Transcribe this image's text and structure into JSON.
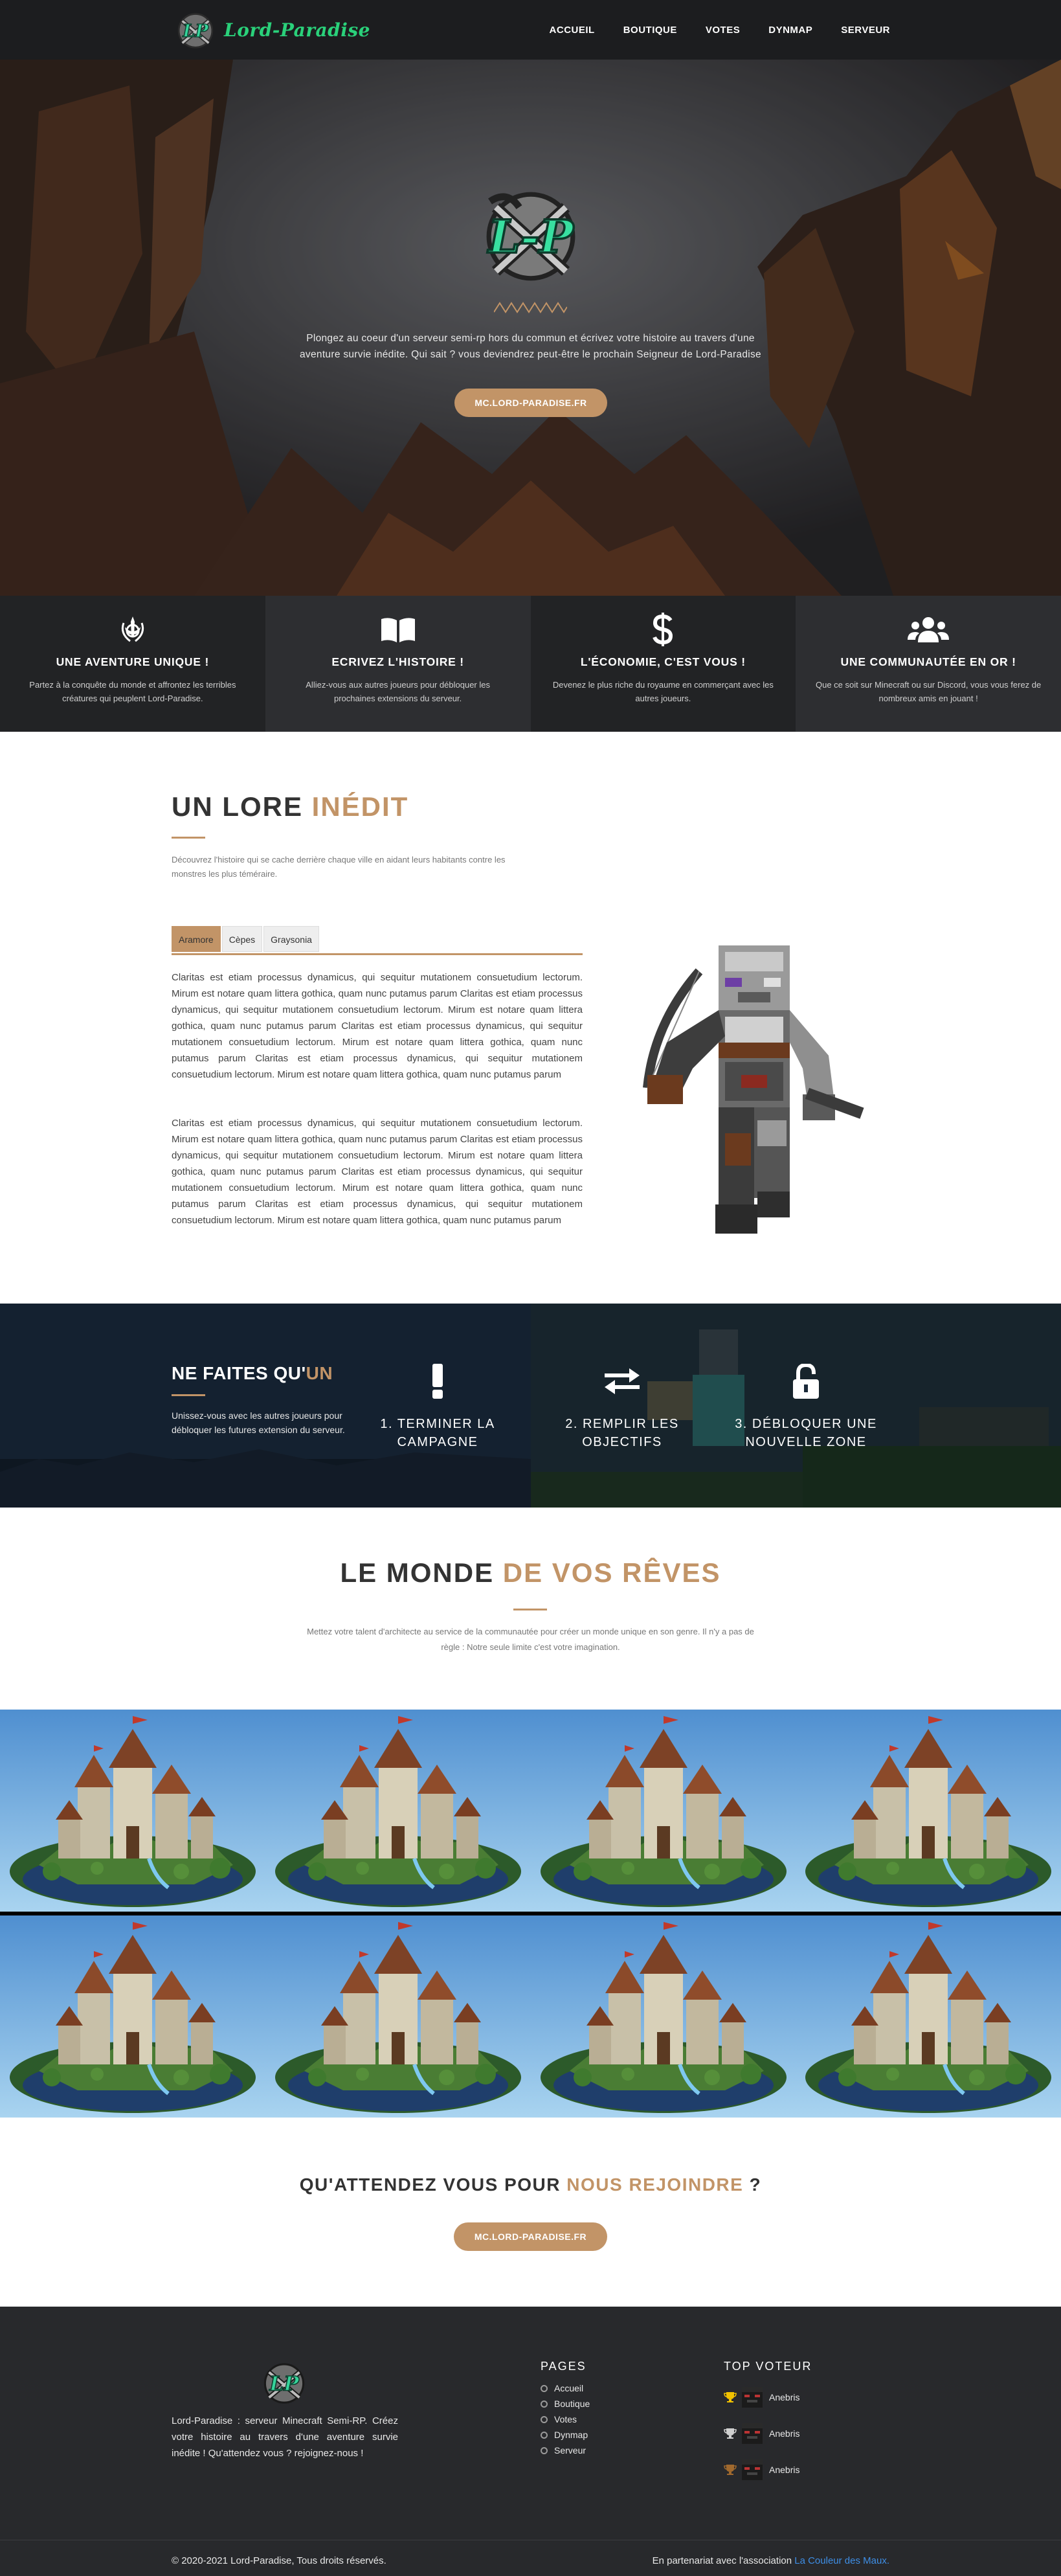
{
  "nav": {
    "brand": "Lord-Paradise",
    "items": [
      "ACCUEIL",
      "BOUTIQUE",
      "VOTES",
      "DYNMAP",
      "SERVEUR"
    ]
  },
  "hero": {
    "logo_text": "L-P",
    "tagline": "Plongez au coeur d'un serveur semi-rp hors du commun et écrivez votre histoire au travers d'une aventure survie inédite. Qui sait ? vous deviendrez peut-être le prochain Seigneur de Lord-Paradise",
    "cta": "MC.LORD-PARADISE.FR"
  },
  "features": [
    {
      "icon": "khanda-icon",
      "title": "UNE AVENTURE UNIQUE !",
      "desc": "Partez à la conquête du monde et affrontez les terribles créatures qui peuplent Lord-Paradise."
    },
    {
      "icon": "open-book-icon",
      "title": "ECRIVEZ L'HISTOIRE !",
      "desc": "Alliez-vous aux autres joueurs pour débloquer les prochaines extensions du serveur."
    },
    {
      "icon": "dollar-icon",
      "title": "L'ÉCONOMIE, C'EST VOUS !",
      "desc": "Devenez le plus riche du royaume en commerçant avec les autres joueurs."
    },
    {
      "icon": "users-icon",
      "title": "UNE COMMUNAUTÉE EN OR !",
      "desc": "Que ce soit sur Minecraft ou sur Discord, vous vous ferez de nombreux amis en jouant !"
    }
  ],
  "lore": {
    "title_plain": "UN LORE ",
    "title_accent": "INÉDIT",
    "subtitle": "Découvrez l'histoire qui se cache derrière chaque ville en aidant leurs habitants contre les monstres les plus téméraire.",
    "tabs": [
      "Aramore",
      "Cèpes",
      "Graysonia"
    ],
    "paragraphs": [
      "Claritas est etiam processus dynamicus, qui sequitur mutationem consuetudium lectorum. Mirum est notare quam littera gothica, quam nunc putamus parum Claritas est etiam processus dynamicus, qui sequitur mutationem consuetudium lectorum. Mirum est notare quam littera gothica, quam nunc putamus parum Claritas est etiam processus dynamicus, qui sequitur mutationem consuetudium lectorum. Mirum est notare quam littera gothica, quam nunc putamus parum Claritas est etiam processus dynamicus, qui sequitur mutationem consuetudium lectorum. Mirum est notare quam littera gothica, quam nunc putamus parum",
      "Claritas est etiam processus dynamicus, qui sequitur mutationem consuetudium lectorum. Mirum est notare quam littera gothica, quam nunc putamus parum Claritas est etiam processus dynamicus, qui sequitur mutationem consuetudium lectorum. Mirum est notare quam littera gothica, quam nunc putamus parum Claritas est etiam processus dynamicus, qui sequitur mutationem consuetudium lectorum. Mirum est notare quam littera gothica, quam nunc putamus parum Claritas est etiam processus dynamicus, qui sequitur mutationem consuetudium lectorum. Mirum est notare quam littera gothica, quam nunc putamus parum"
    ]
  },
  "objectives": {
    "title_plain": "NE FAITES QU'",
    "title_accent": "UN",
    "desc": "Unissez-vous avec les autres joueurs pour débloquer les futures extension du serveur.",
    "steps": [
      {
        "icon": "exclamation-icon",
        "label": "1. TERMINER LA CAMPAGNE"
      },
      {
        "icon": "exchange-icon",
        "label": "2. REMPLIR LES OBJECTIFS"
      },
      {
        "icon": "unlock-icon",
        "label": "3. DÉBLOQUER UNE NOUVELLE ZONE"
      }
    ]
  },
  "world": {
    "title_plain": "LE MONDE ",
    "title_accent": "DE VOS RÊVES",
    "desc": "Mettez votre talent d'architecte au service de la communautée pour créer un monde unique en son genre. Il n'y a pas de règle : Notre seule limite c'est votre imagination."
  },
  "join": {
    "title_plain": "QU'ATTENDEZ VOUS POUR ",
    "title_accent": "NOUS REJOINDRE",
    "title_end": " ?",
    "cta": "MC.LORD-PARADISE.FR"
  },
  "footer": {
    "desc": "Lord-Paradise : serveur Minecraft Semi-RP. Créez votre histoire au travers d'une aventure survie inédite ! Qu'attendez vous ? rejoignez-nous !",
    "pages_title": "PAGES",
    "pages": [
      "Accueil",
      "Boutique",
      "Votes",
      "Dynmap",
      "Serveur"
    ],
    "voters_title": "TOP VOTEUR",
    "voters": [
      "Anebris",
      "Anebris",
      "Anebris"
    ],
    "copyright": "© 2020-2021 Lord-Paradise, Tous droits réservés.",
    "partner_prefix": "En partenariat avec l'association ",
    "partner_link": "La Couleur des Maux."
  },
  "colors": {
    "accent": "#c29467",
    "nav_bg": "#1c1d1f",
    "footer_bg": "#28292c",
    "link": "#3e8ee6"
  }
}
